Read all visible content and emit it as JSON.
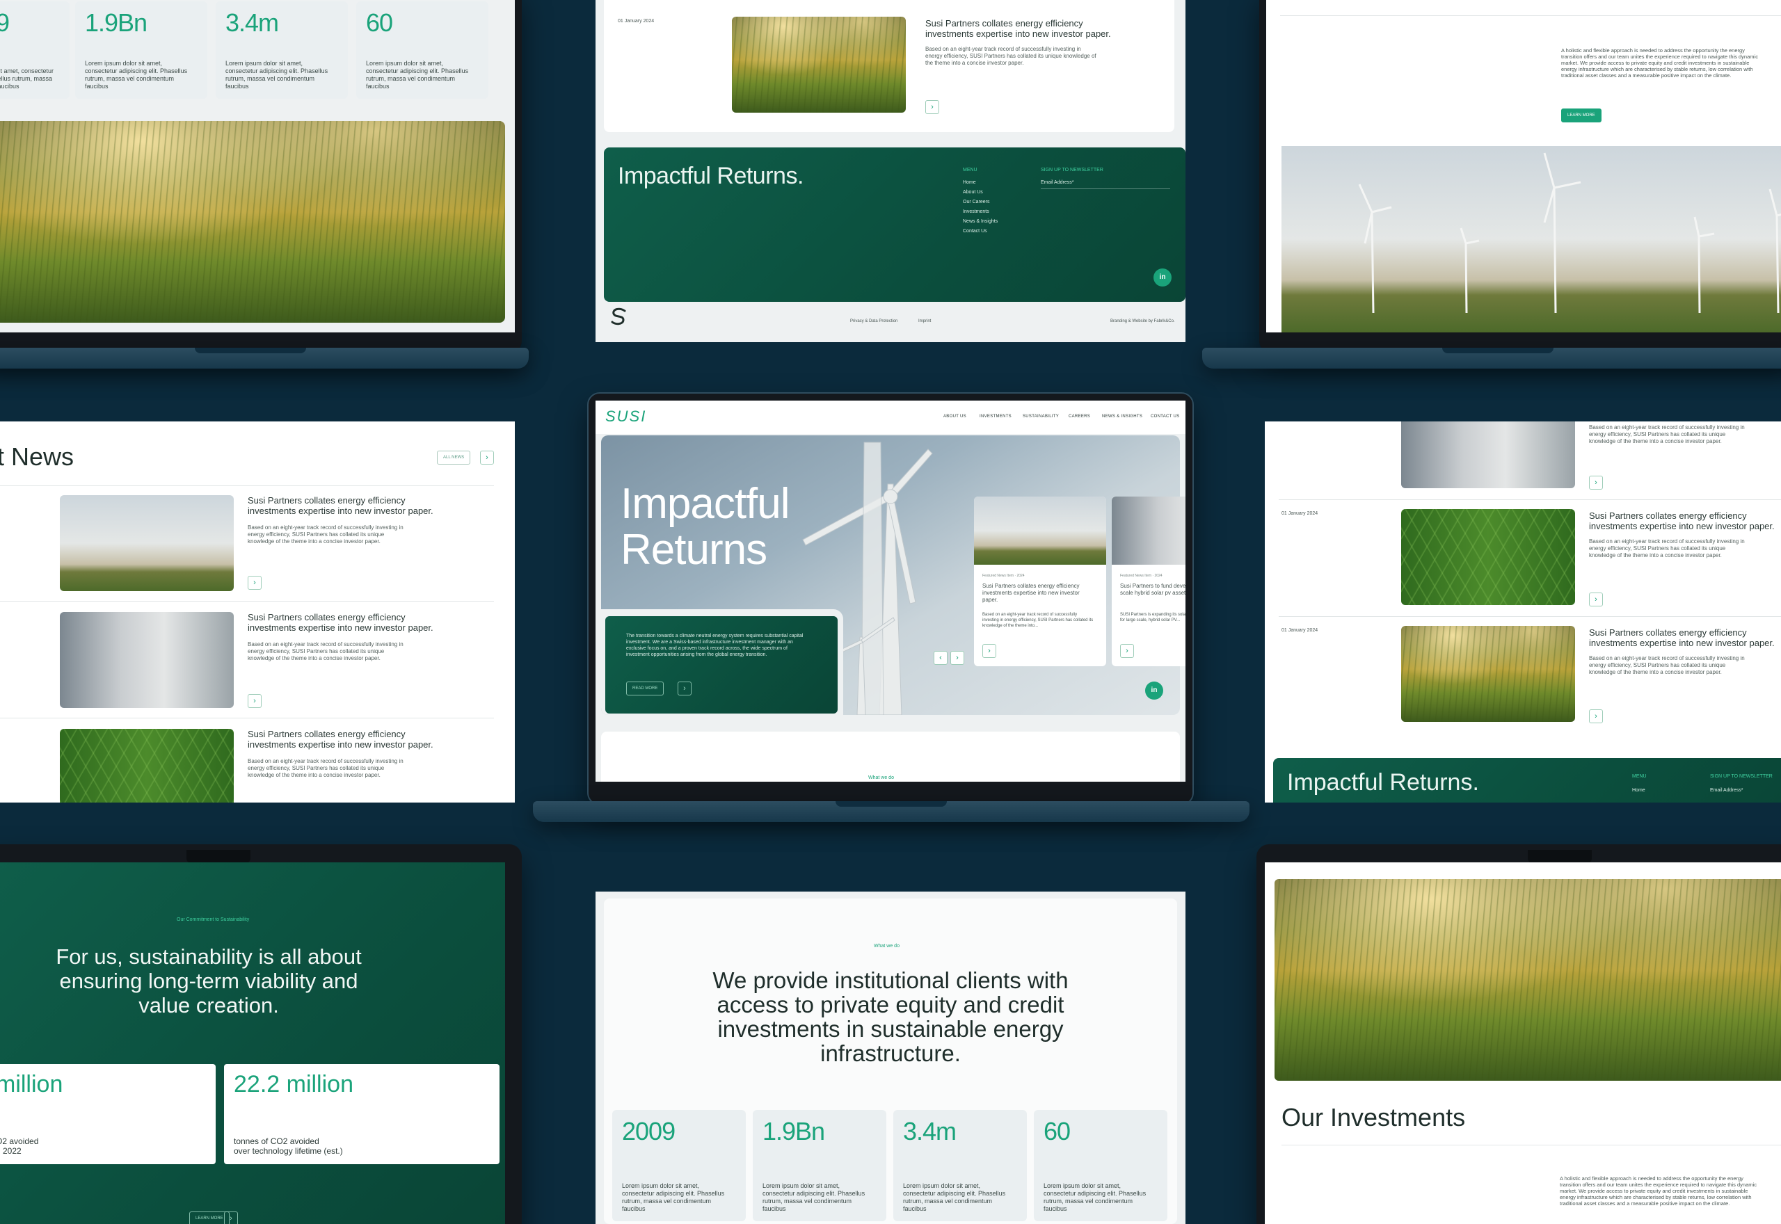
{
  "colors": {
    "background": "#0b2a3c",
    "accent": "#1aa37a",
    "dark_green": "#0f5e4a"
  },
  "brand": {
    "logo": "SUSI",
    "icon": "s-mark-icon"
  },
  "nav": {
    "items": [
      "ABOUT US",
      "INVESTMENTS",
      "SUSTAINABILITY",
      "CAREERS",
      "NEWS & INSIGHTS",
      "CONTACT US"
    ]
  },
  "hero": {
    "title_line1": "Impactful",
    "title_line2": "Returns",
    "intro": "The transition towards a climate neutral energy system requires substantial capital investment. We are a Swiss-based infrastructure investment manager with an exclusive focus on, and a proven track record across, the wide spectrum of investment opportunities arising from the global energy transition.",
    "cta": "READ MORE",
    "card1_meta": "Featured News Item · 2024",
    "card1_title": "Susi Partners collates energy efficiency investments expertise into new investor paper.",
    "card1_body": "Based on an eight-year track record of successfully investing in energy efficiency, SUSI Partners has collated its knowledge of the theme into...",
    "card2_meta": "Featured News Item · 2024",
    "card2_title": "Susi Partners to fund development of large-scale hybrid solar pv assets.",
    "card2_body": "SUSI Partners is expanding its solar energy developer BHO for large scale, hybrid solar PV...",
    "what_we_do": "What we do"
  },
  "stats": [
    {
      "value": "2009",
      "text": "Lorem ipsum dolor sit amet, consectetur adipiscing elit. Phasellus rutrum, massa vel condimentum faucibus"
    },
    {
      "value": "1.9Bn",
      "text": "Lorem ipsum dolor sit amet, consectetur adipiscing elit. Phasellus rutrum, massa vel condimentum faucibus"
    },
    {
      "value": "3.4m",
      "text": "Lorem ipsum dolor sit amet, consectetur adipiscing elit. Phasellus rutrum, massa vel condimentum faucibus"
    },
    {
      "value": "60",
      "text": "Lorem ipsum dolor sit amet, consectetur adipiscing elit. Phasellus rutrum, massa vel condimentum faucibus"
    }
  ],
  "top_left_stats": [
    {
      "value": "9",
      "text": "sit amet, consectetur tellus rutrum, massa faucibus"
    },
    {
      "value": "1.9Bn",
      "text": "Lorem ipsum dolor sit amet, consectetur adipiscing elit. Phasellus rutrum, massa vel condimentum faucibus"
    },
    {
      "value": "3.4m",
      "text": "Lorem ipsum dolor sit amet, consectetur adipiscing elit. Phasellus rutrum, massa vel condimentum faucibus"
    },
    {
      "value": "60",
      "text": "Lorem ipsum dolor sit amet, consectetur adipiscing elit. Phasellus rutrum, massa vel condimentum faucibus"
    }
  ],
  "news": {
    "heading": "t News",
    "all_news": "ALL NEWS",
    "date": "01 January 2024",
    "item_title": "Susi Partners collates energy efficiency investments expertise into new investor paper.",
    "item_body": "Based on an eight-year track record of successfully investing in energy efficiency, SUSI Partners has collated its unique knowledge of the theme into a concise investor paper."
  },
  "footer": {
    "tagline": "Impactful Returns.",
    "menu_heading": "MENU",
    "menu_items": [
      "Home",
      "About Us",
      "Our Careers",
      "Investments",
      "News & Insights",
      "Contact Us"
    ],
    "newsletter_heading": "SIGN UP TO NEWSLETTER",
    "email_placeholder": "Email Address*",
    "privacy": "Privacy & Data Protection",
    "imprint": "Imprint",
    "credit": "Branding & Website by Fabrik&Co."
  },
  "approach": {
    "text": "A holistic and flexible approach is needed to address the opportunity the energy transition offers and our team unites the experience required to navigate this dynamic market. We provide access to private equity and credit investments in sustainable energy infrastructure which are characterised by stable returns, low correlation with traditional asset classes and a measurable positive impact on the climate.",
    "cta": "LEARN MORE"
  },
  "sustainability": {
    "label": "Our Commitment to Sustainability",
    "heading": "For us, sustainability is all about ensuring long-term viability and value creation.",
    "stat1_value": "million",
    "stat1_text_line1": "O2 avoided",
    "stat1_text_line2": "d 2022",
    "stat2_value": "22.2 million",
    "stat2_text_line1": "tonnes of CO2 avoided",
    "stat2_text_line2": "over technology lifetime (est.)",
    "cta": "LEARN MORE"
  },
  "what_we_do": {
    "label": "What we do",
    "heading": "We provide institutional clients with access to private equity and credit investments in sustainable energy infrastructure."
  },
  "investments": {
    "heading": "Our Investments"
  }
}
